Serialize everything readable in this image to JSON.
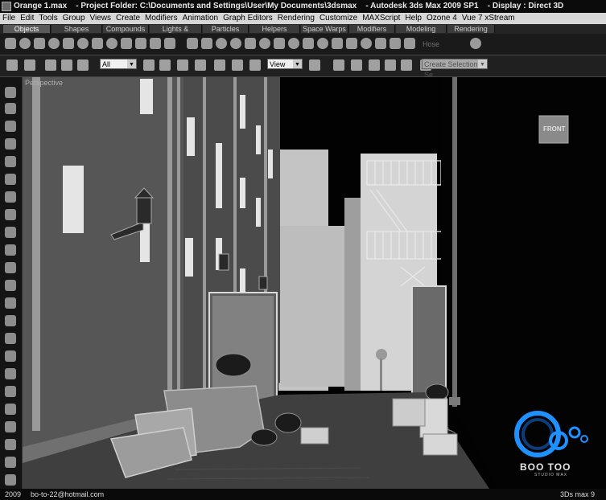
{
  "title": {
    "file": "Orange 1.max",
    "project_folder": "- Project Folder: C:\\Documents and Settings\\User\\My Documents\\3dsmax",
    "app": "- Autodesk 3ds Max  2009 SP1",
    "display": "- Display : Direct 3D"
  },
  "menu": [
    "File",
    "Edit",
    "Tools",
    "Group",
    "Views",
    "Create",
    "Modifiers",
    "Animation",
    "Graph Editors",
    "Rendering",
    "Customize",
    "MAXScript",
    "Help",
    "Ozone 4",
    "Vue 7 xStream"
  ],
  "tabs": [
    "Objects",
    "Shapes",
    "Compounds",
    "Lights & Cameras",
    "Particles",
    "Helpers",
    "Space Warps",
    "Modifiers",
    "Modeling",
    "Rendering"
  ],
  "shelf": {
    "hose_label": "Hose"
  },
  "toolbar": {
    "filter_value": "All",
    "refcoord_value": "View",
    "selection_set_placeholder": "Create Selection Se"
  },
  "viewport": {
    "label": "Perspective",
    "viewcube_label": "FRONT"
  },
  "status": {
    "year": "2009",
    "email": "bo-to-22@hotmail.com",
    "app_version": "3Ds max 9"
  },
  "logo": {
    "title": "BOO TOO",
    "subtitle": "STUDIO MAX"
  },
  "colors": {
    "menu_bg": "#d7d7d7",
    "toolbar_bg": "#202020",
    "viewport_bg": "#000000",
    "logo_blue": "#1e90ff"
  }
}
